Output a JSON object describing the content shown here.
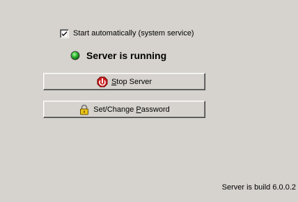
{
  "autostart": {
    "label": "Start automatically (system service)",
    "checked": true
  },
  "status": {
    "text": "Server is running",
    "indicator_color": "#22a822"
  },
  "stop_button": {
    "label_prefix": "",
    "label_mnemonic": "S",
    "label_rest": "top Server",
    "icon": "stop-sign-icon"
  },
  "password_button": {
    "label_prefix": "Set/Change ",
    "label_mnemonic": "P",
    "label_rest": "assword",
    "icon": "padlock-icon"
  },
  "footer": {
    "build_text": "Server is build 6.0.0.2"
  },
  "colors": {
    "background": "#d6d3ce",
    "stop_icon": "#cc2020",
    "lock_body": "#e8c21a"
  }
}
